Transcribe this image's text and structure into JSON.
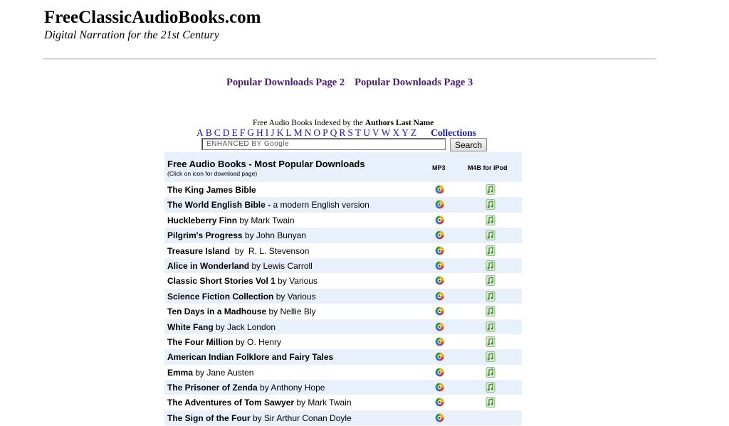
{
  "header": {
    "site_title": "FreeClassicAudioBooks.com",
    "tagline": "Digital Narration for the 21st Century"
  },
  "popular_links": [
    {
      "label": "Popular Downloads Page 2"
    },
    {
      "label": "Popular Downloads Page 3"
    }
  ],
  "index": {
    "caption_prefix": "Free Audio Books Indexed by the ",
    "caption_bold": "Authors Last Name",
    "letters": [
      "A",
      "B",
      "C",
      "D",
      "E",
      "F",
      "G",
      "H",
      "I",
      "J",
      "K",
      "L",
      "M",
      "N",
      "O",
      "P",
      "Q",
      "R",
      "S",
      "T",
      "U",
      "V",
      "W",
      "X",
      "Y",
      "Z"
    ],
    "collections_label": "Collections"
  },
  "search": {
    "placeholder": "ENHANCED BY Google",
    "button_label": "Search"
  },
  "table": {
    "title": "Free Audio Books - Most Popular Downloads",
    "subtitle": "(Click on icon for download page)",
    "col_mp3": "MP3",
    "col_m4b": "M4B for iPod",
    "icons": {
      "mp3": "mp3-audio-icon",
      "m4b": "ipod-music-icon"
    },
    "rows": [
      {
        "title": "The King James Bible",
        "author_text": "",
        "mp3": true,
        "m4b": true
      },
      {
        "title": "The World English Bible - ",
        "author_text": "a modern English version",
        "mp3": true,
        "m4b": true
      },
      {
        "title": "Huckleberry Finn",
        "author_text": " by Mark Twain",
        "mp3": true,
        "m4b": true
      },
      {
        "title": "Pilgrim's Progress",
        "author_text": " by John Bunyan",
        "mp3": true,
        "m4b": true
      },
      {
        "title": "Treasure Island",
        "author_text": "  by  R. L. Stevenson",
        "mp3": true,
        "m4b": true
      },
      {
        "title": "Alice in Wonderland",
        "author_text": " by Lewis Carroll",
        "mp3": true,
        "m4b": true
      },
      {
        "title": "Classic Short Stories Vol 1",
        "author_text": " by Various",
        "mp3": true,
        "m4b": true
      },
      {
        "title": "Science Fiction Collection",
        "author_text": " by Various",
        "mp3": true,
        "m4b": true
      },
      {
        "title": "Ten Days in a Madhouse",
        "author_text": " by Nellie Bly",
        "mp3": true,
        "m4b": true
      },
      {
        "title": "White Fang",
        "author_text": " by Jack London",
        "mp3": true,
        "m4b": true
      },
      {
        "title": "The Four Million",
        "author_text": " by O. Henry",
        "mp3": true,
        "m4b": true
      },
      {
        "title": "American Indian Folklore and Fairy Tales",
        "author_text": "",
        "mp3": true,
        "m4b": true
      },
      {
        "title": "Emma",
        "author_text": " by Jane Austen",
        "mp3": true,
        "m4b": true
      },
      {
        "title": "The Prisoner of Zenda",
        "author_text": " by Anthony Hope",
        "mp3": true,
        "m4b": true
      },
      {
        "title": "The Adventures of Tom Sawyer",
        "author_text": " by Mark Twain",
        "mp3": true,
        "m4b": true
      },
      {
        "title": "The Sign of the Four",
        "author_text": " by Sir Arthur Conan Doyle",
        "mp3": true,
        "m4b": false
      }
    ]
  }
}
